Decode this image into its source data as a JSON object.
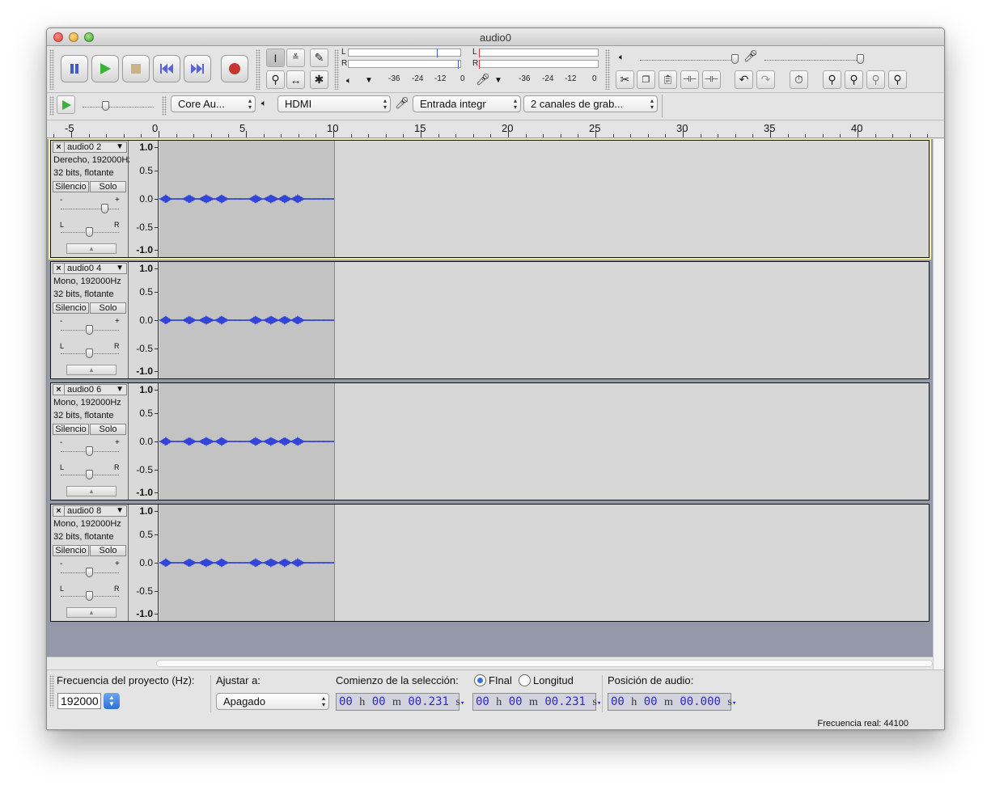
{
  "window": {
    "title": "audio0"
  },
  "meters": {
    "play_L": "L",
    "play_R": "R",
    "rec_L": "L",
    "rec_R": "R",
    "scale": [
      "-36",
      "-24",
      "-12",
      "0"
    ]
  },
  "device": {
    "host": "Core Au...",
    "output": "HDMI",
    "input": "Entrada integr",
    "channels": "2 canales de grab..."
  },
  "ruler": {
    "ticks": [
      "-5",
      "0",
      "5",
      "10",
      "15",
      "20",
      "25",
      "30",
      "35",
      "40"
    ]
  },
  "tracks": [
    {
      "name": "audio0 2",
      "info1": "Derecho, 192000Hz",
      "info2": "32 bits, flotante",
      "mute": "Silencio",
      "solo": "Solo",
      "selected": true
    },
    {
      "name": "audio0 4",
      "info1": "Mono, 192000Hz",
      "info2": "32 bits, flotante",
      "mute": "Silencio",
      "solo": "Solo",
      "selected": false
    },
    {
      "name": "audio0 6",
      "info1": "Mono, 192000Hz",
      "info2": "32 bits, flotante",
      "mute": "Silencio",
      "solo": "Solo",
      "selected": false
    },
    {
      "name": "audio0 8",
      "info1": "Mono, 192000Hz",
      "info2": "32 bits, flotante",
      "mute": "Silencio",
      "solo": "Solo",
      "selected": false
    }
  ],
  "vruler": [
    "1.0",
    "0.5",
    "0.0",
    "-0.5",
    "-1.0"
  ],
  "selection_bar": {
    "rate_label": "Frecuencia del proyecto (Hz):",
    "rate_value": "192000",
    "snap_label": "Ajustar a:",
    "snap_value": "Apagado",
    "start_label": "Comienzo de la selección:",
    "end_option": "FInal",
    "length_option": "Longitud",
    "audio_pos_label": "Posición de audio:",
    "start_time": {
      "h": "00",
      "m": "00",
      "s": "00.231"
    },
    "end_time": {
      "h": "00",
      "m": "00",
      "s": "00.231"
    },
    "audio_pos": {
      "h": "00",
      "m": "00",
      "s": "00.000"
    },
    "unit_h": "h",
    "unit_m": "m",
    "unit_s": "s"
  },
  "status": {
    "actual_rate": "Frecuencia real: 44100"
  },
  "colors": {
    "waveform": "#3245d8",
    "selection": "#c3c3c3",
    "track_bg": "#d7d7d7",
    "background": "#9598a9"
  }
}
